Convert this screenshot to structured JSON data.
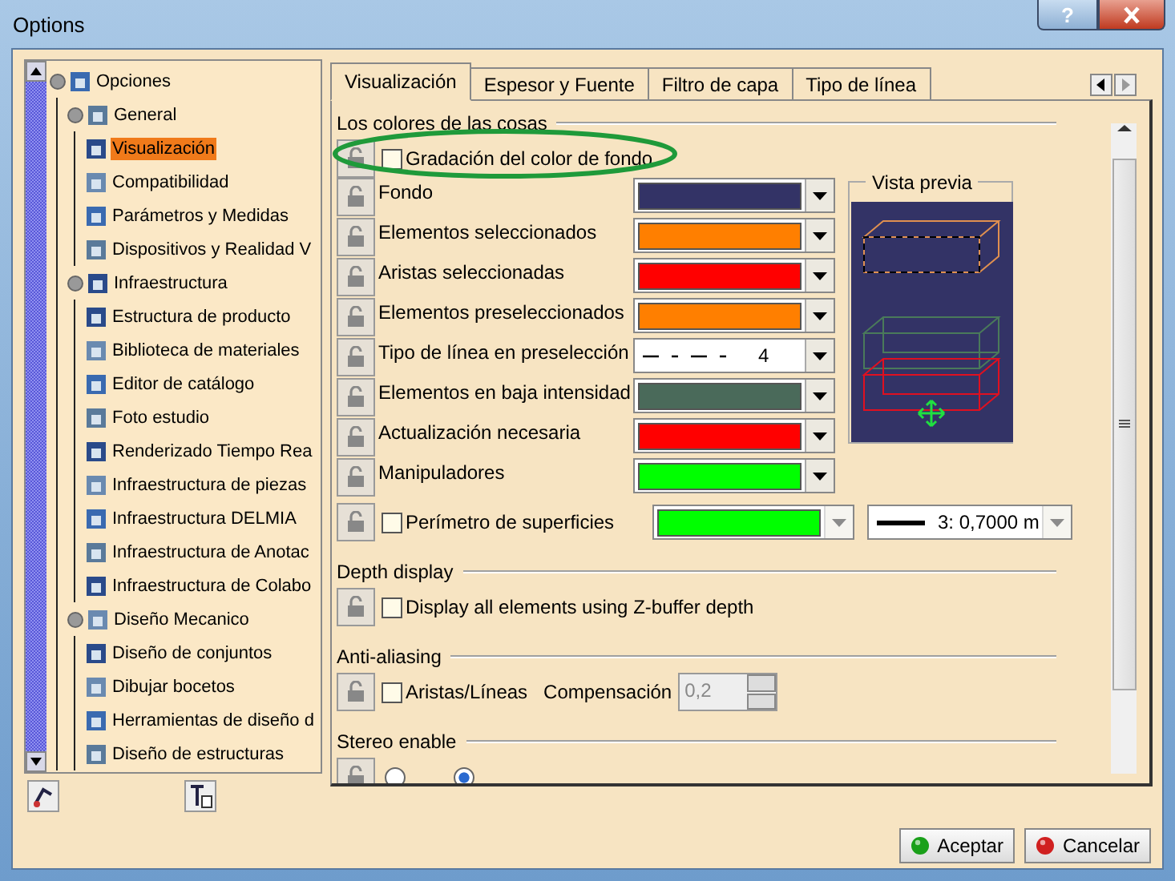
{
  "window": {
    "title": "Options",
    "help_label": "?"
  },
  "tree": {
    "items": [
      {
        "label": "Opciones",
        "selected": false,
        "expanded": true,
        "children": [
          {
            "label": "General",
            "selected": false,
            "expanded": true,
            "children": [
              {
                "label": "Visualización",
                "selected": true
              },
              {
                "label": "Compatibilidad",
                "selected": false
              },
              {
                "label": "Parámetros y Medidas",
                "selected": false
              },
              {
                "label": "Dispositivos y Realidad V",
                "selected": false
              }
            ]
          },
          {
            "label": "Infraestructura",
            "selected": false,
            "expanded": true,
            "children": [
              {
                "label": "Estructura de producto",
                "selected": false
              },
              {
                "label": "Biblioteca de materiales",
                "selected": false
              },
              {
                "label": "Editor de catálogo",
                "selected": false
              },
              {
                "label": "Foto estudio",
                "selected": false
              },
              {
                "label": "Renderizado Tiempo Rea",
                "selected": false
              },
              {
                "label": "Infraestructura de piezas",
                "selected": false
              },
              {
                "label": "Infraestructura DELMIA",
                "selected": false
              },
              {
                "label": "Infraestructura de Anotac",
                "selected": false
              },
              {
                "label": "Infraestructura de Colabo",
                "selected": false
              }
            ]
          },
          {
            "label": "Diseño Mecanico",
            "selected": false,
            "expanded": true,
            "children": [
              {
                "label": "Diseño de conjuntos",
                "selected": false
              },
              {
                "label": "Dibujar bocetos",
                "selected": false
              },
              {
                "label": "Herramientas de diseño d",
                "selected": false
              },
              {
                "label": "Diseño de estructuras",
                "selected": false
              }
            ]
          }
        ]
      }
    ]
  },
  "tabs": [
    {
      "label": "Visualización",
      "selected": true
    },
    {
      "label": "Espesor y Fuente",
      "selected": false
    },
    {
      "label": "Filtro de capa",
      "selected": false
    },
    {
      "label": "Tipo de línea",
      "selected": false
    }
  ],
  "sections": [
    {
      "kind": "colors",
      "title": "Los colores de las cosas",
      "gradient": {
        "label": "Gradación del color de fondo",
        "checked": false,
        "highlighted": true
      },
      "rows": [
        {
          "kind": "color",
          "label": "Fondo",
          "color": "#333366"
        },
        {
          "kind": "color",
          "label": "Elementos seleccionados",
          "color": "#ff7f00"
        },
        {
          "kind": "color",
          "label": "Aristas seleccionadas",
          "color": "#ff0000"
        },
        {
          "kind": "color",
          "label": "Elementos preseleccionados",
          "color": "#ff7f00"
        },
        {
          "kind": "linetype",
          "label": "Tipo de línea en preselección",
          "value": "4"
        },
        {
          "kind": "color",
          "label": "Elementos en baja intensidad",
          "color": "#4a6a5a"
        },
        {
          "kind": "color",
          "label": "Actualización necesaria",
          "color": "#ff0000"
        },
        {
          "kind": "color",
          "label": "Manipuladores",
          "color": "#00ff00"
        }
      ],
      "perimeter": {
        "label": "Perímetro de superficies",
        "checked": false,
        "color": "#00ff00",
        "thickness": "3: 0,7000 m",
        "disabled": true
      },
      "preview": {
        "title": "Vista previa"
      }
    },
    {
      "kind": "checkbox",
      "title": "Depth display",
      "option": {
        "label": "Display all elements using Z-buffer depth",
        "checked": false
      }
    },
    {
      "kind": "antialias",
      "title": "Anti-aliasing",
      "option": {
        "label": "Aristas/Líneas",
        "checked": false
      },
      "offset": {
        "label": "Compensación",
        "value": "0,2",
        "disabled": true
      }
    },
    {
      "kind": "radio",
      "title": "Stereo enable",
      "options": [
        {
          "selected": false
        },
        {
          "selected": true
        }
      ]
    }
  ],
  "buttons": [
    {
      "kind": "ok",
      "label": "Aceptar"
    },
    {
      "kind": "cancel",
      "label": "Cancelar"
    }
  ]
}
